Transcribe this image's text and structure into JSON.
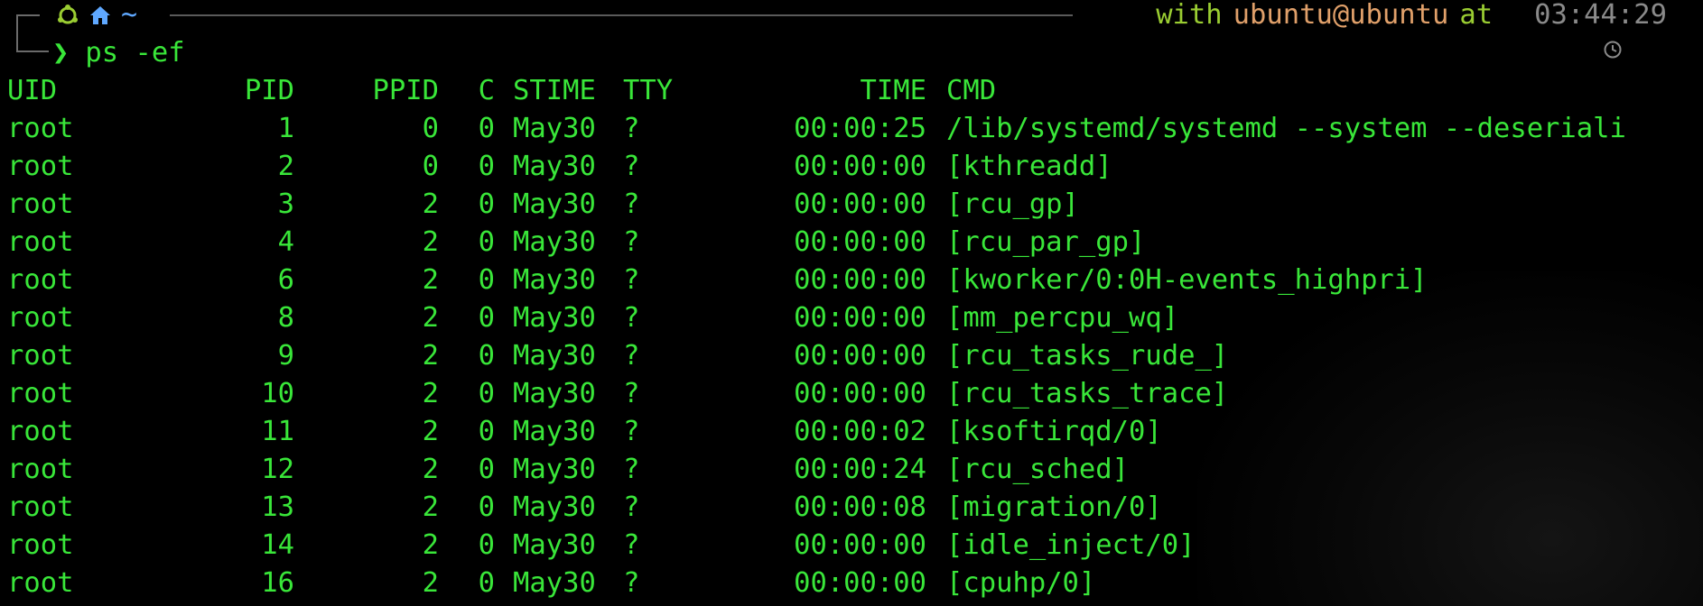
{
  "prompt": {
    "home_symbol": "~",
    "with_label": "with",
    "user_host": "ubuntu@ubuntu",
    "at_label": "at",
    "time": "03:44:29",
    "chevron": "❯",
    "command": "ps -ef"
  },
  "colors": {
    "text": "#39e639",
    "user": "#e0a06a",
    "keyword": "#9acd32",
    "muted": "#8a8a8a",
    "tilde": "#5fa8ff",
    "background": "#000000"
  },
  "table": {
    "headers": {
      "uid": "UID",
      "pid": "PID",
      "ppid": "PPID",
      "c": "C",
      "stime": "STIME",
      "tty": "TTY",
      "time": "TIME",
      "cmd": "CMD"
    },
    "rows": [
      {
        "uid": "root",
        "pid": "1",
        "ppid": "0",
        "c": "0",
        "stime": "May30",
        "tty": "?",
        "time": "00:00:25",
        "cmd": "/lib/systemd/systemd --system --deseriali"
      },
      {
        "uid": "root",
        "pid": "2",
        "ppid": "0",
        "c": "0",
        "stime": "May30",
        "tty": "?",
        "time": "00:00:00",
        "cmd": "[kthreadd]"
      },
      {
        "uid": "root",
        "pid": "3",
        "ppid": "2",
        "c": "0",
        "stime": "May30",
        "tty": "?",
        "time": "00:00:00",
        "cmd": "[rcu_gp]"
      },
      {
        "uid": "root",
        "pid": "4",
        "ppid": "2",
        "c": "0",
        "stime": "May30",
        "tty": "?",
        "time": "00:00:00",
        "cmd": "[rcu_par_gp]"
      },
      {
        "uid": "root",
        "pid": "6",
        "ppid": "2",
        "c": "0",
        "stime": "May30",
        "tty": "?",
        "time": "00:00:00",
        "cmd": "[kworker/0:0H-events_highpri]"
      },
      {
        "uid": "root",
        "pid": "8",
        "ppid": "2",
        "c": "0",
        "stime": "May30",
        "tty": "?",
        "time": "00:00:00",
        "cmd": "[mm_percpu_wq]"
      },
      {
        "uid": "root",
        "pid": "9",
        "ppid": "2",
        "c": "0",
        "stime": "May30",
        "tty": "?",
        "time": "00:00:00",
        "cmd": "[rcu_tasks_rude_]"
      },
      {
        "uid": "root",
        "pid": "10",
        "ppid": "2",
        "c": "0",
        "stime": "May30",
        "tty": "?",
        "time": "00:00:00",
        "cmd": "[rcu_tasks_trace]"
      },
      {
        "uid": "root",
        "pid": "11",
        "ppid": "2",
        "c": "0",
        "stime": "May30",
        "tty": "?",
        "time": "00:00:02",
        "cmd": "[ksoftirqd/0]"
      },
      {
        "uid": "root",
        "pid": "12",
        "ppid": "2",
        "c": "0",
        "stime": "May30",
        "tty": "?",
        "time": "00:00:24",
        "cmd": "[rcu_sched]"
      },
      {
        "uid": "root",
        "pid": "13",
        "ppid": "2",
        "c": "0",
        "stime": "May30",
        "tty": "?",
        "time": "00:00:08",
        "cmd": "[migration/0]"
      },
      {
        "uid": "root",
        "pid": "14",
        "ppid": "2",
        "c": "0",
        "stime": "May30",
        "tty": "?",
        "time": "00:00:00",
        "cmd": "[idle_inject/0]"
      },
      {
        "uid": "root",
        "pid": "16",
        "ppid": "2",
        "c": "0",
        "stime": "May30",
        "tty": "?",
        "time": "00:00:00",
        "cmd": "[cpuhp/0]"
      }
    ]
  },
  "icons": {
    "ubuntu": "ubuntu-logo-icon",
    "home": "home-icon",
    "clock": "clock-icon"
  }
}
